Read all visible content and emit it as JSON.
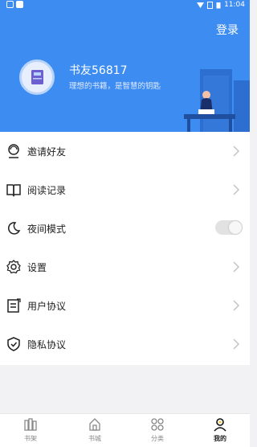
{
  "status_bar": {
    "time": "11:04"
  },
  "header": {
    "login_label": "登录",
    "nickname": "书友56817",
    "motto": "理想的书籍，是智慧的钥匙"
  },
  "menu": {
    "items": [
      {
        "label": "邀请好友",
        "icon": "invite-icon"
      },
      {
        "label": "阅读记录",
        "icon": "book-icon"
      },
      {
        "label": "夜间模式",
        "icon": "moon-icon",
        "toggle_on": false
      },
      {
        "label": "设置",
        "icon": "gear-icon"
      },
      {
        "label": "用户协议",
        "icon": "agreement-icon"
      },
      {
        "label": "隐私协议",
        "icon": "shield-icon"
      }
    ]
  },
  "tabbar": {
    "tabs": [
      {
        "label": "书架",
        "icon": "bookshelf-icon"
      },
      {
        "label": "书城",
        "icon": "bookstore-icon"
      },
      {
        "label": "分类",
        "icon": "category-icon"
      },
      {
        "label": "我的",
        "icon": "user-icon",
        "active": true
      }
    ]
  },
  "colors": {
    "brand": "#3d8cf2",
    "page_bg": "#f2f2f4"
  }
}
